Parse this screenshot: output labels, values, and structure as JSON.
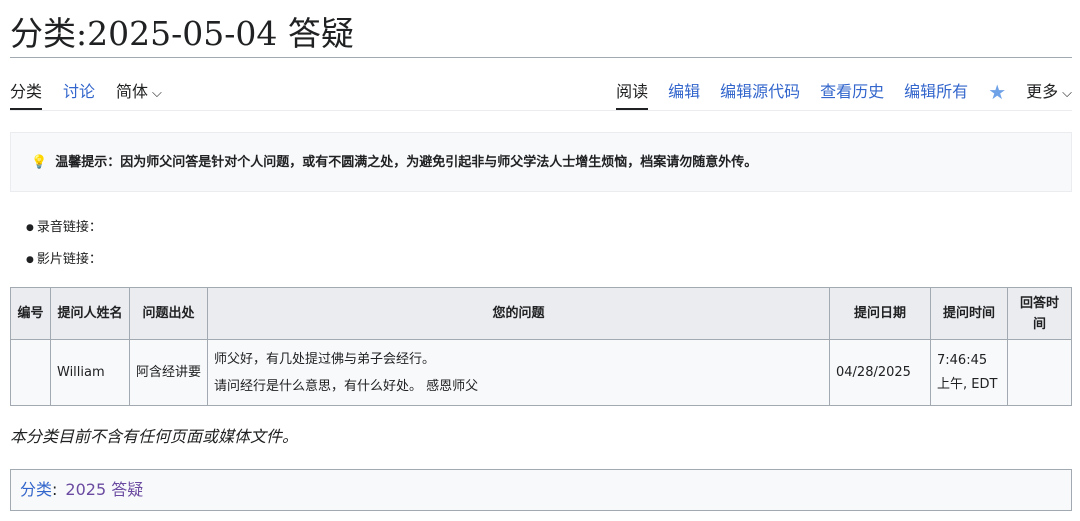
{
  "page": {
    "title": "分类:2025-05-04 答疑"
  },
  "tabs": {
    "left": [
      {
        "label": "分类"
      },
      {
        "label": "讨论"
      },
      {
        "label": "简体"
      }
    ],
    "right": [
      {
        "label": "阅读"
      },
      {
        "label": "编辑"
      },
      {
        "label": "编辑源代码"
      },
      {
        "label": "查看历史"
      },
      {
        "label": "编辑所有"
      },
      {
        "label": "更多"
      }
    ],
    "icons": {
      "watch": "star-icon",
      "dropdown": "chevron-down-icon"
    }
  },
  "notice": {
    "icon": "lightbulb-icon",
    "text": "温馨提示：因为师父问答是针对个人问题，或有不圆满之处，为避免引起非与师父学法人士增生烦恼，档案请勿随意外传。"
  },
  "links": [
    {
      "label": "录音链接："
    },
    {
      "label": "影片链接："
    }
  ],
  "table": {
    "headers": [
      "编号",
      "提问人姓名",
      "问题出处",
      "您的问题",
      "提问日期",
      "提问时间",
      "回答时间"
    ],
    "rows": [
      {
        "id": "",
        "name": "William",
        "source": "阿含经讲要",
        "question": [
          "师父好，有几处提过佛与弟子会经行。",
          "请问经行是什么意思，有什么好处。 感恩师父"
        ],
        "date": "04/28/2025",
        "time": "7:46:45 上午, EDT",
        "answer_time": ""
      }
    ]
  },
  "empty_note": "本分类目前不含有任何页面或媒体文件。",
  "categories": {
    "label": "分类",
    "items": [
      {
        "label": "2025 答疑"
      }
    ]
  },
  "colors": {
    "link": "#3366cc",
    "visited": "#6b4ba1",
    "header_bg": "#eaecf0",
    "border": "#a2a9b1"
  }
}
